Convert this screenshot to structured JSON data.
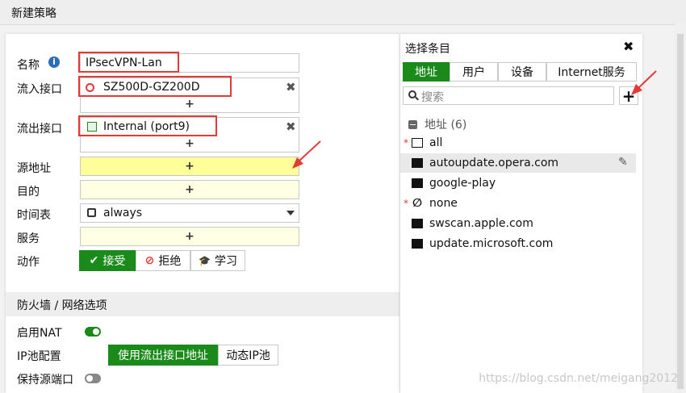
{
  "page": {
    "title": "新建策略"
  },
  "form": {
    "name_label": "名称",
    "name_value": "IPsecVPN-Lan",
    "in_label": "流入接口",
    "in_value": "SZ500D-GZ200D",
    "out_label": "流出接口",
    "out_value": "Internal (port9)",
    "src_label": "源地址",
    "dst_label": "目的",
    "schedule_label": "时间表",
    "schedule_value": "always",
    "service_label": "服务",
    "action_label": "动作",
    "action_accept": "接受",
    "action_deny": "拒绝",
    "action_learn": "学习",
    "plus": "+"
  },
  "firewall": {
    "section_title": "防火墙 / 网络选项",
    "nat_label": "启用NAT",
    "nat_enabled": true,
    "ippool_label": "IP池配置",
    "ippool_opt1": "使用流出接口地址",
    "ippool_opt2": "动态IP池",
    "preserve_port_label": "保持源端口",
    "preserve_port_enabled": false
  },
  "panel": {
    "title": "选择条目",
    "tabs": [
      "地址",
      "用户",
      "设备",
      "Internet服务"
    ],
    "search_placeholder": "搜索",
    "group_label": "地址 (6)",
    "items": [
      {
        "name": "all",
        "required": true
      },
      {
        "name": "autoupdate.opera.com",
        "required": false
      },
      {
        "name": "google-play",
        "required": false
      },
      {
        "name": "none",
        "required": true
      },
      {
        "name": "swscan.apple.com",
        "required": false
      },
      {
        "name": "update.microsoft.com",
        "required": false
      }
    ]
  },
  "watermark": "https://blog.csdn.net/meigang2012",
  "colors": {
    "accent": "#1a8a1a",
    "highlight": "#e53935",
    "active_field": "#ffff99"
  }
}
